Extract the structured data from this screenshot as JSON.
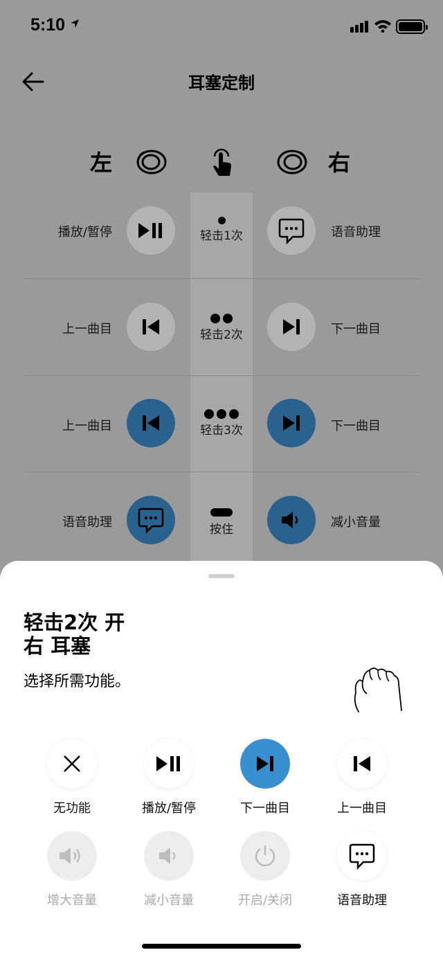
{
  "status_bar": {
    "time": "5:10"
  },
  "header": {
    "title": "耳塞定制"
  },
  "ears": {
    "left_label": "左",
    "right_label": "右"
  },
  "rows": [
    {
      "left_action": "播放/暂停",
      "gesture": "轻击1次",
      "right_action": "语音助理",
      "left_icon": "play-pause-icon",
      "right_icon": "voice-assistant-icon",
      "highlighted": false
    },
    {
      "left_action": "上一曲目",
      "gesture": "轻击2次",
      "right_action": "下一曲目",
      "left_icon": "previous-track-icon",
      "right_icon": "next-track-icon",
      "highlighted": false
    },
    {
      "left_action": "上一曲目",
      "gesture": "轻击3次",
      "right_action": "下一曲目",
      "left_icon": "previous-track-icon",
      "right_icon": "next-track-icon",
      "highlighted": true
    },
    {
      "left_action": "语音助理",
      "gesture": "按住",
      "right_action": "减小音量",
      "left_icon": "voice-assistant-icon",
      "right_icon": "volume-down-icon",
      "highlighted": true
    }
  ],
  "sheet": {
    "title_line1": "轻击2次 开",
    "title_line2": "右 耳塞",
    "subtitle": "选择所需功能。",
    "options": [
      {
        "label": "无功能",
        "icon": "close-icon",
        "state": "normal"
      },
      {
        "label": "播放/暂停",
        "icon": "play-pause-icon",
        "state": "normal"
      },
      {
        "label": "下一曲目",
        "icon": "next-track-icon",
        "state": "selected"
      },
      {
        "label": "上一曲目",
        "icon": "previous-track-icon",
        "state": "normal"
      },
      {
        "label": "增大音量",
        "icon": "volume-up-icon",
        "state": "disabled"
      },
      {
        "label": "减小音量",
        "icon": "volume-down-icon",
        "state": "disabled"
      },
      {
        "label": "开启/关闭",
        "icon": "power-icon",
        "state": "disabled"
      },
      {
        "label": "语音助理",
        "icon": "voice-assistant-icon",
        "state": "normal"
      }
    ]
  },
  "colors": {
    "active_dark": "#2b618d",
    "selected": "#3a8fd1",
    "overlay_bg": "#9a9a9a"
  }
}
